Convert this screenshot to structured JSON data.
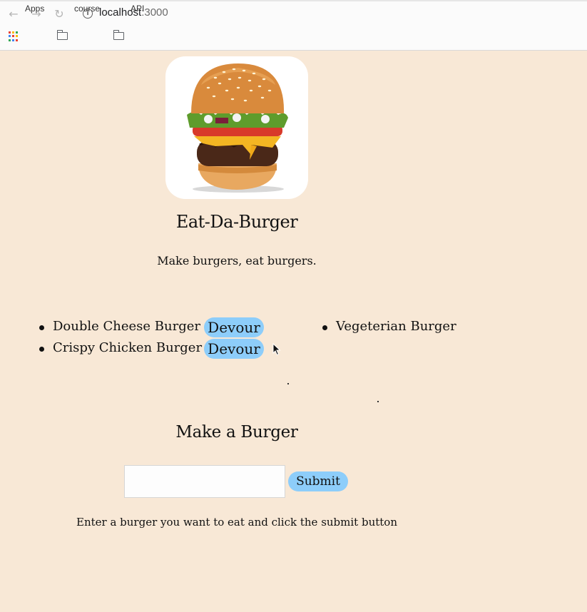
{
  "browser": {
    "url_host": "localhost",
    "url_port": ":3000",
    "bookmarks": [
      {
        "label": "Apps",
        "icon": "apps-grid-icon"
      },
      {
        "label": "course",
        "icon": "folder-icon"
      },
      {
        "label": "API",
        "icon": "folder-icon"
      }
    ]
  },
  "header": {
    "logo": "burger-image",
    "title": "Eat-Da-Burger",
    "tagline": "Make burgers, eat burgers."
  },
  "burgers": {
    "not_devoured": [
      {
        "name": "Double Cheese Burger",
        "button": "Devour"
      },
      {
        "name": "Crispy Chicken Burger",
        "button": "Devour"
      }
    ],
    "devoured": [
      {
        "name": "Vegeterian Burger"
      }
    ]
  },
  "form": {
    "title": "Make a Burger",
    "input_value": "",
    "submit_label": "Submit",
    "hint": "Enter a burger you want to eat and click the submit button"
  },
  "colors": {
    "background": "#f8e8d6",
    "button": "#8dcdfa"
  }
}
